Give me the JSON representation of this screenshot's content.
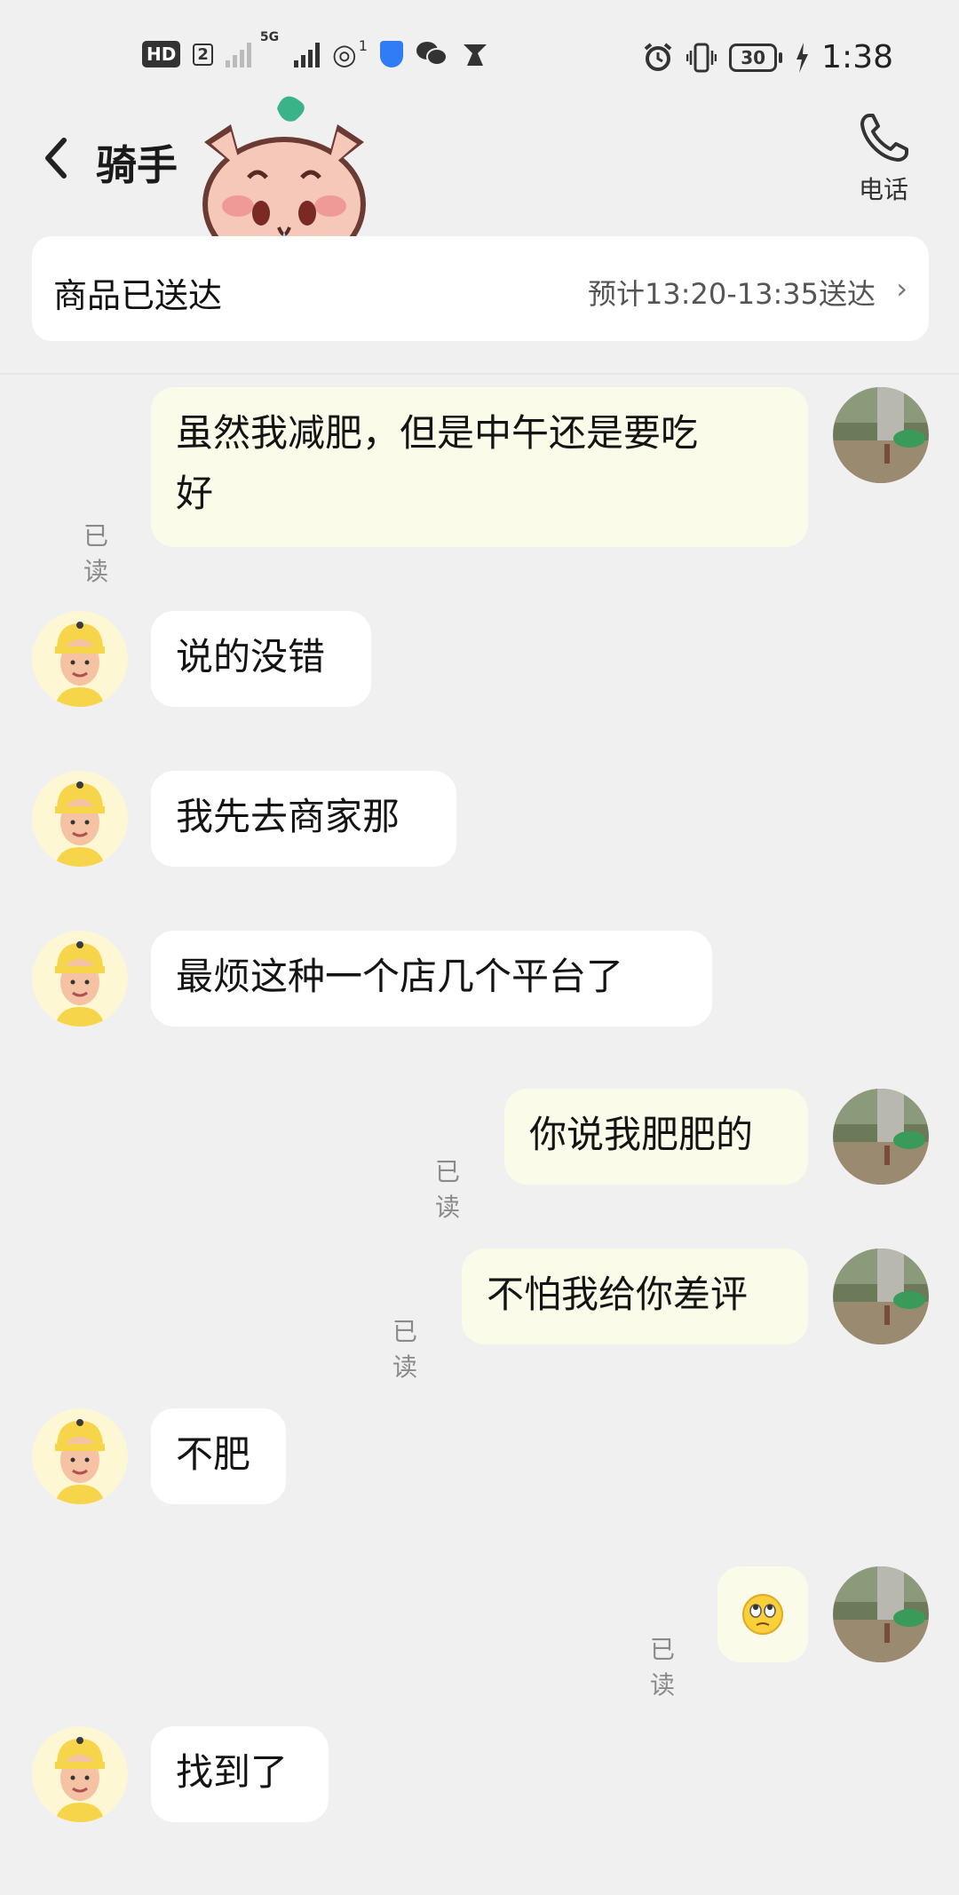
{
  "status_bar": {
    "hd": "HD",
    "sim": "2",
    "network": "5G",
    "hotspot_count": "1",
    "battery": "30",
    "time": "1:38",
    "icons": [
      "signal-icon",
      "hotspot-icon",
      "shield-icon",
      "wechat-icon",
      "app-icon",
      "alarm-icon",
      "vibrate-icon",
      "battery-icon",
      "charging-icon"
    ]
  },
  "header": {
    "title": "骑手",
    "call_label": "电话"
  },
  "delivery": {
    "status": "商品已送达",
    "eta": "预计13:20-13:35送达",
    "chevron": "›"
  },
  "messages": [
    {
      "from": "me",
      "text": "虽然我减肥，但是中午还是要吃\n好",
      "read": "已读"
    },
    {
      "from": "rider",
      "text": "说的没错"
    },
    {
      "from": "rider",
      "text": "我先去商家那"
    },
    {
      "from": "rider",
      "text": "最烦这种一个店几个平台了"
    },
    {
      "from": "me",
      "text": "你说我肥肥的",
      "read": "已读"
    },
    {
      "from": "me",
      "text": "不怕我给你差评",
      "read": "已读"
    },
    {
      "from": "rider",
      "text": "不肥"
    },
    {
      "from": "me",
      "text": "",
      "emoji": "eye-roll-emoji",
      "read": "已读"
    },
    {
      "from": "rider",
      "text": "找到了"
    }
  ],
  "colors": {
    "background": "#f0f0f0",
    "my_bubble": "#fbfbe9",
    "rider_bubble": "#ffffff",
    "rider_helmet": "#f7d54a"
  }
}
